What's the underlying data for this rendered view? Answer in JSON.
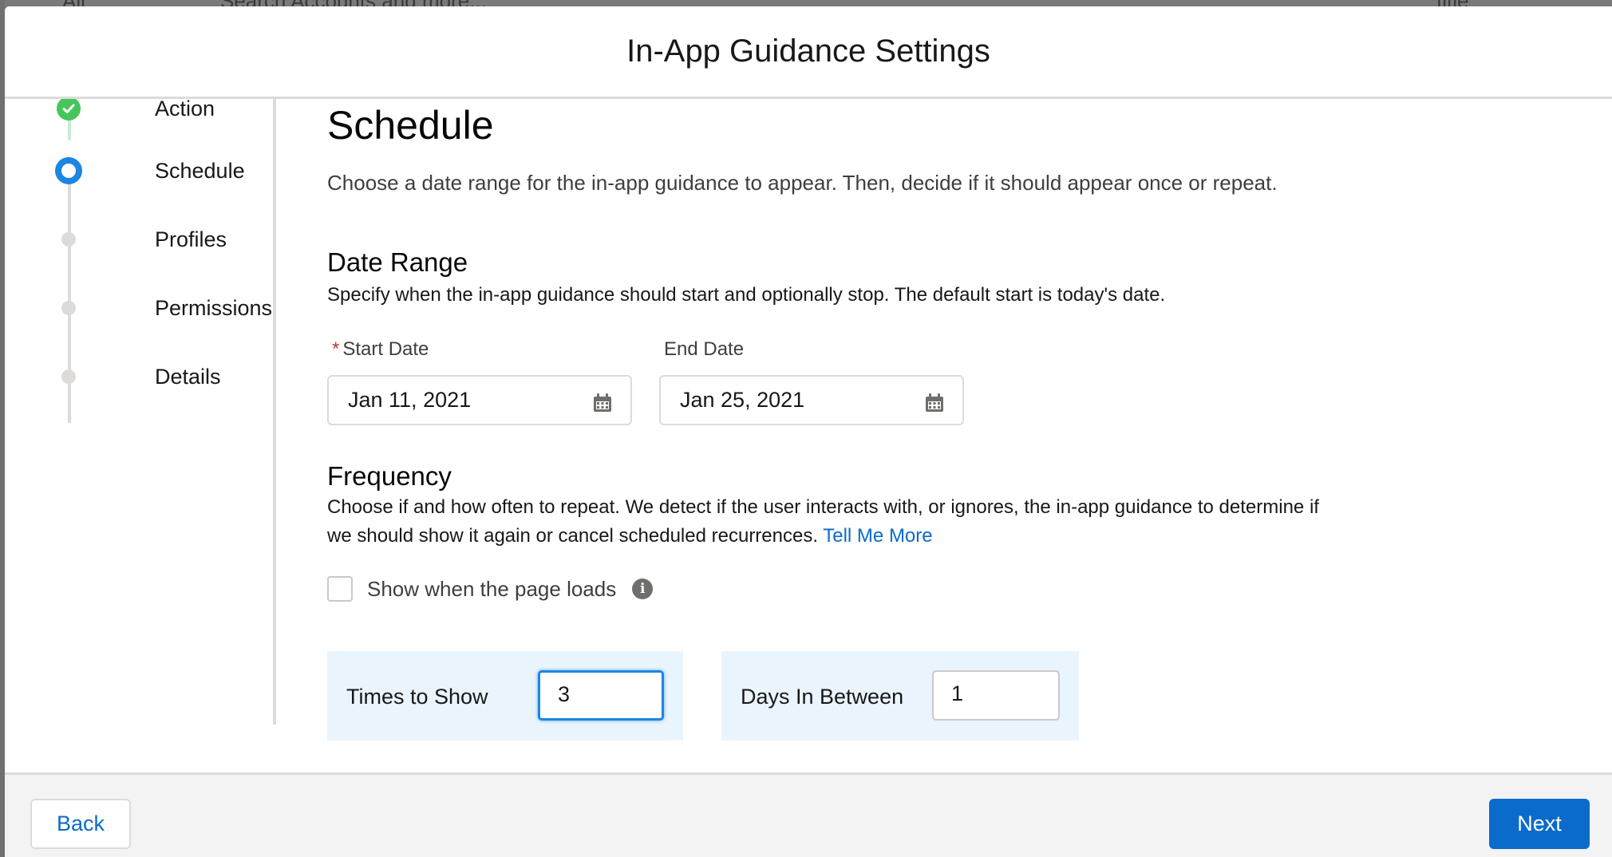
{
  "background": {
    "scope_label": "All",
    "search_placeholder": "Search Accounts and more...",
    "user_text": "fitle"
  },
  "modal": {
    "title": "In-App Guidance Settings"
  },
  "steps": [
    {
      "label": "Action",
      "state": "complete"
    },
    {
      "label": "Schedule",
      "state": "active"
    },
    {
      "label": "Profiles",
      "state": "incomplete"
    },
    {
      "label": "Permissions",
      "state": "incomplete"
    },
    {
      "label": "Details",
      "state": "incomplete"
    }
  ],
  "schedule": {
    "heading": "Schedule",
    "intro": "Choose a date range for the in-app guidance to appear. Then, decide if it should appear once or repeat.",
    "date_range": {
      "heading": "Date Range",
      "description": "Specify when the in-app guidance should start and optionally stop. The default start is today's date.",
      "start_label": "Start Date",
      "required_marker": "*",
      "start_value": "Jan 11, 2021",
      "end_label": "End Date",
      "end_value": "Jan 25, 2021"
    },
    "frequency": {
      "heading": "Frequency",
      "description_line1": "Choose if and how often to repeat. We detect if the user interacts with, or ignores, the in-app guidance to determine if",
      "description_line2": "we should show it again or cancel scheduled recurrences.",
      "link": "Tell Me More",
      "checkbox_label": "Show when the page loads",
      "checkbox_checked": false,
      "info_icon": "i",
      "times_label": "Times to Show",
      "times_value": "3",
      "days_label": "Days In Between",
      "days_value": "1"
    }
  },
  "footer": {
    "back_label": "Back",
    "next_label": "Next"
  },
  "colors": {
    "brand": "#0b6bcb",
    "active_step": "#1b86e0",
    "complete_step": "#45c65a",
    "required": "#c23934",
    "panel": "#eaf4fd"
  }
}
